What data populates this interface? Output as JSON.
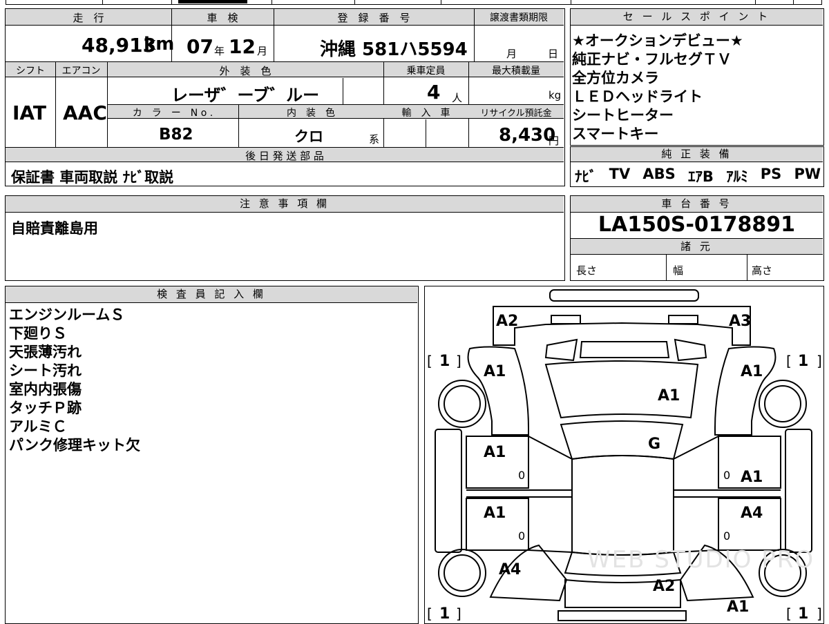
{
  "top_strip": {},
  "vehicle": {
    "mileage_label": "走　行",
    "mileage_value": "48,913",
    "mileage_unit": "km",
    "inspection_label": "車　検",
    "inspection_year": "07",
    "inspection_year_unit": "年",
    "inspection_month": "12",
    "inspection_month_unit": "月",
    "registration_label": "登　録　番　号",
    "registration_value": "沖縄 581ハ5594",
    "transfer_docs_label": "譲渡書類期限",
    "transfer_month_unit": "月",
    "transfer_day_unit": "日",
    "shift_label": "シフト",
    "aircon_label": "エアコン",
    "shift_value": "IAT",
    "aircon_value": "AAC",
    "exterior_color_label": "外　装　色",
    "exterior_color_value": "レーザ゛ーブ゛ルー",
    "capacity_label": "乗車定員",
    "capacity_value": "4",
    "capacity_unit": "人",
    "max_load_label": "最大積載量",
    "max_load_unit": "kg",
    "color_no_label": "カ　ラ　ー　N o .",
    "color_no_value": "B82",
    "interior_color_label": "内　装　色",
    "interior_color_value": "クロ",
    "interior_color_suffix": "系",
    "import_label": "輸　入　車",
    "recycle_label": "リサイクル預託金",
    "recycle_value": "8,430",
    "recycle_unit": "円"
  },
  "sales_points": {
    "header": "セ ー ル ス ポ イ ン ト",
    "items": [
      "★オークションデビュー★",
      "純正ナビ・フルセグＴＶ",
      "全方位カメラ",
      "ＬＥＤヘッドライト",
      "シートヒーター",
      "スマートキー"
    ]
  },
  "later_parts": {
    "header": "後 日 発 送 部 品",
    "value": "保証書 車両取説 ﾅﾋﾞ取説"
  },
  "genuine_equipment": {
    "header": "純 正 装 備",
    "items": [
      "ﾅﾋﾞ",
      "TV",
      "ABS",
      "ｴｱB",
      "ｱﾙﾐ",
      "PS",
      "PW"
    ]
  },
  "notes": {
    "header": "注 意 事 項 欄",
    "value": "自賠責離島用"
  },
  "chassis": {
    "header": "車 台 番 号",
    "value": "LA150S-0178891",
    "spec_header": "諸 元",
    "length_label": "長さ",
    "width_label": "幅",
    "height_label": "高さ"
  },
  "inspector": {
    "header": "検 査 員 記 入 欄",
    "lines": [
      "エンジンルームＳ",
      "下廻りＳ",
      "天張薄汚れ",
      "シート汚れ",
      "室内内張傷",
      "タッチＰ跡",
      "アルミＣ",
      "パンク修理キット欠"
    ]
  },
  "diagram": {
    "marks": {
      "front_left_corner": "A2",
      "front_right_corner": "A3",
      "left_front_fender": "A1",
      "right_front_fender": "A1",
      "hood": "A1",
      "windshield": "G",
      "left_front_door": "A1",
      "right_front_door": "A1",
      "left_rear_door": "A1",
      "right_rear_door": "A4",
      "left_rear_fender": "A4",
      "trunk": "A2",
      "right_rear_corner": "A1"
    },
    "wheel_counts": [
      "1",
      "1",
      "1",
      "1"
    ],
    "sill_marks": [
      "0",
      "0",
      "0",
      "0"
    ],
    "watermark": "WEB STUDIO PRO"
  }
}
